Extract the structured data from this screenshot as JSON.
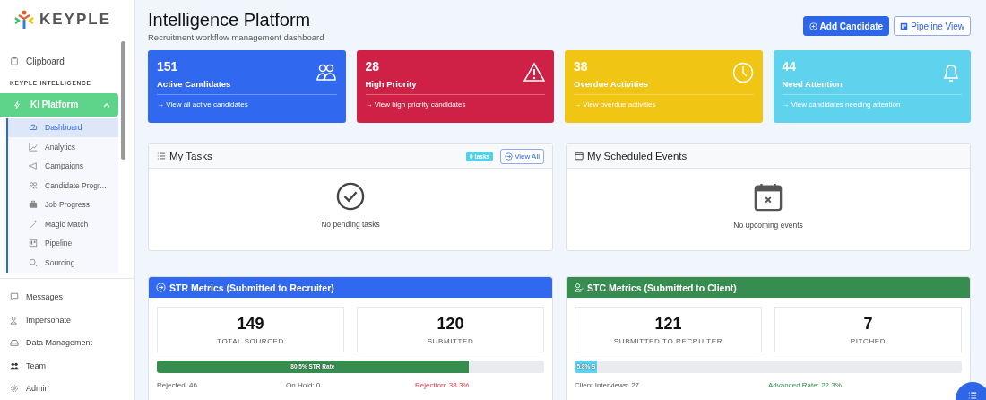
{
  "brand": {
    "name": "KEYPLE"
  },
  "sidebar": {
    "top_items": [
      {
        "label": "Clipboard"
      }
    ],
    "section_label": "KEYPLE INTELLIGENCE",
    "group": {
      "label": "KI Platform",
      "expanded": true,
      "children": [
        {
          "label": "Dashboard",
          "selected": true
        },
        {
          "label": "Analytics",
          "selected": false
        },
        {
          "label": "Campaigns",
          "selected": false
        },
        {
          "label": "Candidate Progr...",
          "selected": false
        },
        {
          "label": "Job Progress",
          "selected": false
        },
        {
          "label": "Magic Match",
          "selected": false
        },
        {
          "label": "Pipeline",
          "selected": false
        },
        {
          "label": "Sourcing",
          "selected": false
        }
      ]
    },
    "bottom_items": [
      {
        "label": "Messages"
      },
      {
        "label": "Impersonate"
      },
      {
        "label": "Data Management"
      },
      {
        "label": "Team"
      },
      {
        "label": "Admin"
      }
    ]
  },
  "header": {
    "title": "Intelligence Platform",
    "subtitle": "Recruitment workflow management dashboard",
    "buttons": [
      {
        "label": "Add Candidate",
        "kind": "primary"
      },
      {
        "label": "Pipeline View",
        "kind": "outline"
      }
    ]
  },
  "stat_cards": [
    {
      "value": "151",
      "label": "Active Candidates",
      "link": "→ View all active candidates",
      "color": "#3068f0"
    },
    {
      "value": "28",
      "label": "High Priority",
      "link": "→ View high priority candidates",
      "color": "#cf2146"
    },
    {
      "value": "38",
      "label": "Overdue Activities",
      "link": "→ View overdue activities",
      "color": "#f0c514"
    },
    {
      "value": "44",
      "label": "Need Attention",
      "link": "→ View candidates needing attention",
      "color": "#5fd3ee"
    }
  ],
  "tasks_panel": {
    "title": "My Tasks",
    "badge": "0 tasks",
    "button": "View All",
    "empty_text": "No pending tasks"
  },
  "events_panel": {
    "title": "My Scheduled Events",
    "empty_text": "No upcoming events"
  },
  "metrics": [
    {
      "title": "STR Metrics (Submitted to Recruiter)",
      "color": "#3068f0",
      "stats": [
        {
          "value": "149",
          "label": "TOTAL SOURCED"
        },
        {
          "value": "120",
          "label": "SUBMITTED"
        }
      ],
      "progress": {
        "level": 0.805,
        "label": "80.5% STR Rate",
        "color": "#378c50"
      },
      "footer": [
        {
          "text": "Rejected: 46",
          "kind": "neutral"
        },
        {
          "text": "On Hold: 0",
          "kind": "neutral"
        },
        {
          "text": "Rejection: 38.3%",
          "kind": "danger"
        }
      ]
    },
    {
      "title": "STC Metrics (Submitted to Client)",
      "color": "#378c50",
      "stats": [
        {
          "value": "121",
          "label": "SUBMITTED TO RECRUITER"
        },
        {
          "value": "7",
          "label": "PITCHED"
        }
      ],
      "progress": {
        "level": 0.058,
        "label": "5.8% S",
        "color": "#5fd3ee"
      },
      "footer": [
        {
          "text": "Client Interviews: 27",
          "kind": "neutral"
        },
        {
          "text": "Advanced Rate: 22.3%",
          "kind": "success"
        }
      ]
    }
  ]
}
